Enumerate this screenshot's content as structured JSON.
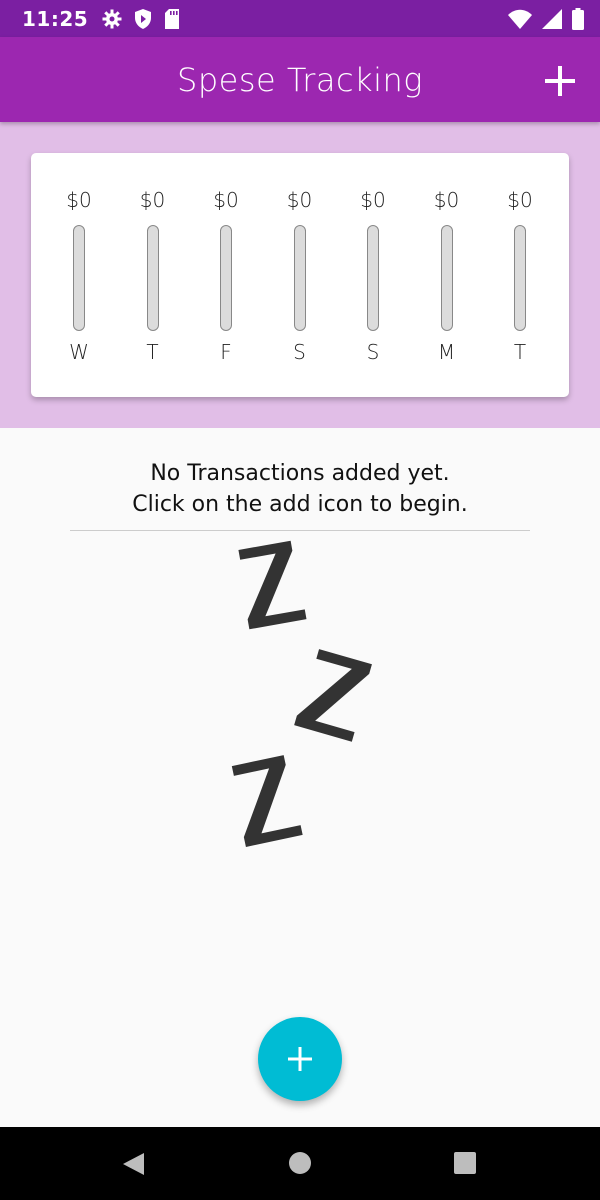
{
  "status_bar": {
    "time": "11:25",
    "icons_left": [
      "settings-icon",
      "shield-icon",
      "sd-card-icon"
    ],
    "icons_right": [
      "wifi-icon",
      "signal-icon",
      "battery-icon"
    ]
  },
  "app_bar": {
    "title": "Spese Tracking",
    "action_icon": "add-icon",
    "color": "#9c27b0"
  },
  "chart": {
    "background": "#e1bee7",
    "bars": [
      {
        "day": "W",
        "amount": "$0",
        "fraction": 0
      },
      {
        "day": "T",
        "amount": "$0",
        "fraction": 0
      },
      {
        "day": "F",
        "amount": "$0",
        "fraction": 0
      },
      {
        "day": "S",
        "amount": "$0",
        "fraction": 0
      },
      {
        "day": "S",
        "amount": "$0",
        "fraction": 0
      },
      {
        "day": "M",
        "amount": "$0",
        "fraction": 0
      },
      {
        "day": "T",
        "amount": "$0",
        "fraction": 0
      }
    ]
  },
  "empty_state": {
    "line1": "No Transactions added yet.",
    "line2": "Click on the add icon to begin.",
    "illustration": "sleeping-zzz-icon"
  },
  "fab": {
    "icon": "add-icon",
    "color": "#00bcd4"
  },
  "nav_bar": {
    "buttons": [
      "back-icon",
      "home-icon",
      "recents-icon"
    ]
  }
}
